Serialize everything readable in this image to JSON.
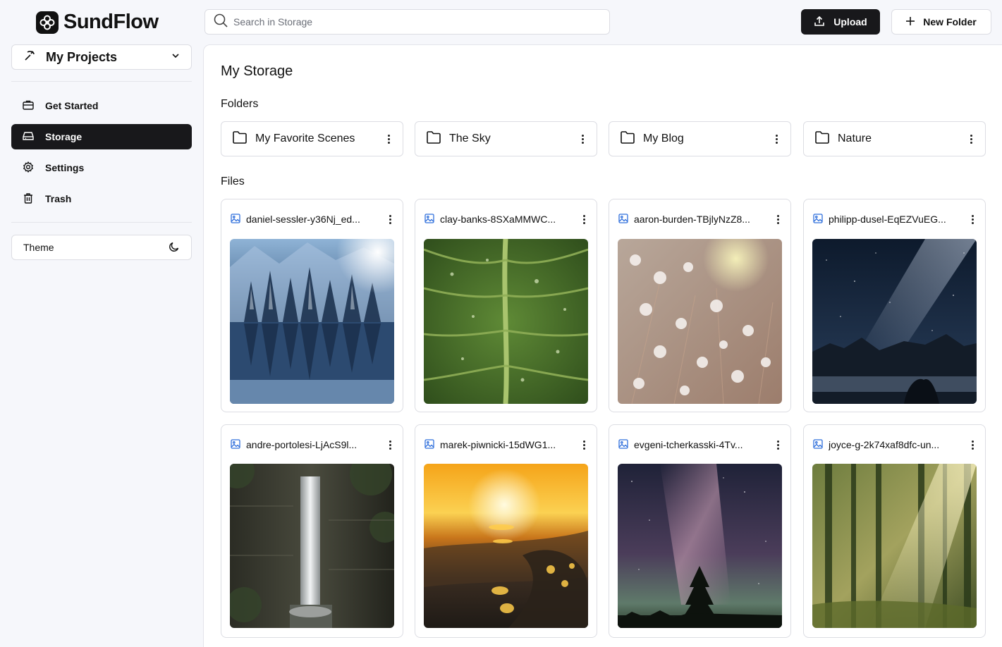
{
  "app": {
    "name": "SundFlow"
  },
  "search": {
    "placeholder": "Search in Storage",
    "value": ""
  },
  "toolbar": {
    "upload_label": "Upload",
    "new_folder_label": "New Folder"
  },
  "project": {
    "label": "My Projects"
  },
  "sidebar": {
    "items": [
      {
        "label": "Get Started",
        "icon": "briefcase-icon",
        "active": false
      },
      {
        "label": "Storage",
        "icon": "hard-drive-icon",
        "active": true
      },
      {
        "label": "Settings",
        "icon": "gear-icon",
        "active": false
      },
      {
        "label": "Trash",
        "icon": "trash-icon",
        "active": false
      }
    ],
    "theme_label": "Theme"
  },
  "main": {
    "title": "My Storage",
    "folders_heading": "Folders",
    "files_heading": "Files",
    "folders": [
      {
        "name": "My Favorite Scenes"
      },
      {
        "name": "The Sky"
      },
      {
        "name": "My Blog"
      },
      {
        "name": "Nature"
      }
    ],
    "files": [
      {
        "name": "daniel-sessler-y36Nj_ed...",
        "scene": "snowy forest lake"
      },
      {
        "name": "clay-banks-8SXaMMWC...",
        "scene": "green leaf with water drops"
      },
      {
        "name": "aaron-burden-TBjlyNzZ8...",
        "scene": "white flowers"
      },
      {
        "name": "philipp-dusel-EqEZVuEG...",
        "scene": "milky way over mountains"
      },
      {
        "name": "andre-portolesi-LjAcS9l...",
        "scene": "waterfall"
      },
      {
        "name": "marek-piwnicki-15dWG1...",
        "scene": "sunset over sea"
      },
      {
        "name": "evgeni-tcherkasski-4Tv...",
        "scene": "night sky with tree"
      },
      {
        "name": "joyce-g-2k74xaf8dfc-un...",
        "scene": "sunlit forest"
      }
    ]
  },
  "colors": {
    "accent": "#18181b",
    "file_icon": "#2f6fdc"
  }
}
